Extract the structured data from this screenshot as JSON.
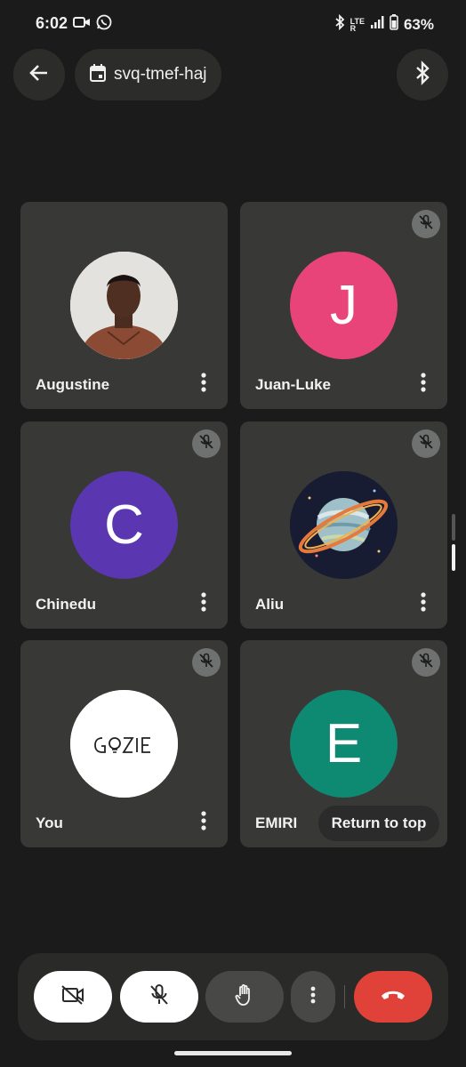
{
  "status_bar": {
    "time": "6:02",
    "lte_label_top": "LTE",
    "lte_label_bottom": "R",
    "battery": "63%",
    "icons": [
      "video-camera-icon",
      "whatsapp-icon",
      "bluetooth-icon",
      "signal-icon",
      "battery-icon"
    ]
  },
  "header": {
    "meeting_code": "svq-tmef-haj",
    "icons": [
      "back-arrow-icon",
      "calendar-icon",
      "bluetooth-icon"
    ]
  },
  "participants": [
    {
      "name": "Augustine",
      "avatar": "photo",
      "muted": false
    },
    {
      "name": "Juan-Luke",
      "initial": "J",
      "color": "#e8447a",
      "muted": true
    },
    {
      "name": "Chinedu",
      "initial": "C",
      "color": "#5a36b0",
      "muted": true
    },
    {
      "name": "Aliu",
      "avatar": "planet-image",
      "muted": true
    },
    {
      "name": "You",
      "avatar": "gozie-logo",
      "logo_text": "GOZIE",
      "muted": true
    },
    {
      "name": "EMIRI",
      "initial": "E",
      "color": "#0e8a73",
      "muted": true
    }
  ],
  "return_to_top": "Return to top",
  "controls": {
    "icons": [
      "camera-off-icon",
      "mic-off-icon",
      "raise-hand-icon",
      "more-vert-icon",
      "end-call-icon"
    ],
    "end_color": "#e0423a"
  }
}
